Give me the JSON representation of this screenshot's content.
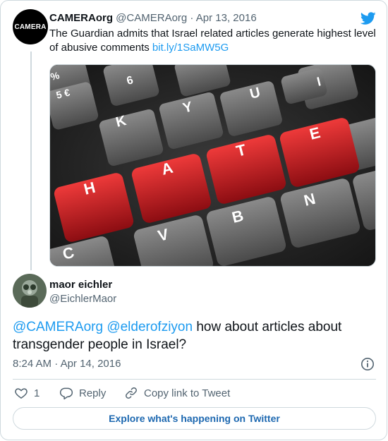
{
  "parent_tweet": {
    "avatar_text": "CAMERA",
    "name": "CAMERAorg",
    "handle": "@CAMERAorg",
    "date": "Apr 13, 2016",
    "text": "The Guardian admits that Israel related articles generate highest level of abusive comments",
    "link": "bit.ly/1SaMW5G",
    "media": {
      "keys_top": [
        "%",
        "5 €",
        "6",
        "I",
        "U",
        "K",
        "Y"
      ],
      "keys_red": [
        "H",
        "A",
        "T",
        "E"
      ],
      "keys_bottom": [
        "V",
        "B",
        "N",
        "C"
      ]
    }
  },
  "reply_tweet": {
    "name": "maor eichler",
    "handle": "@EichlerMaor",
    "mention1": "@CAMERAorg",
    "mention2": "@elderofziyon",
    "text": "how about articles about transgender people in Israel?",
    "time": "8:24 AM",
    "date": "Apr 14, 2016"
  },
  "actions": {
    "like_count": "1",
    "reply_label": "Reply",
    "copy_label": "Copy link to Tweet"
  },
  "explore_label": "Explore what's happening on Twitter",
  "colors": {
    "accent": "#1d9bf0",
    "muted": "#536471",
    "border": "#cfd9de",
    "key_red": "#c8141c"
  }
}
